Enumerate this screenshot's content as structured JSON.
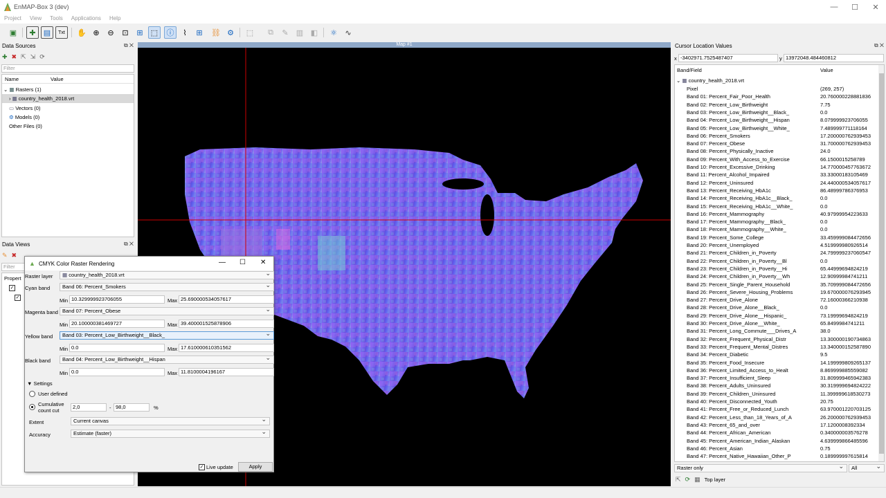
{
  "app": {
    "title": "EnMAP-Box 3 (dev)"
  },
  "window_controls": {
    "minimize": "—",
    "maximize": "☐",
    "close": "✕"
  },
  "menu": [
    "Project",
    "View",
    "Tools",
    "Applications",
    "Help"
  ],
  "toolbar_icons": [
    "open-project-icon",
    "add-data-icon",
    "save-icon",
    "text-icon",
    "pan-icon",
    "zoom-in-icon",
    "zoom-out-icon",
    "zoom-full-icon",
    "zoom-layer-icon",
    "select-icon",
    "identify-icon",
    "spectral-profile-icon",
    "pixel-grid-icon",
    "link-icon",
    "settings-icon",
    "select-features-icon",
    "deselect-icon",
    "digitize-icon",
    "save-edits-icon",
    "layer-style-icon",
    "processing-icon",
    "wave-icon"
  ],
  "data_sources": {
    "title": "Data Sources",
    "filter_placeholder": "Filter",
    "col_name": "Name",
    "col_value": "Value",
    "rasters": "Rasters (1)",
    "raster_file": "country_health_2018.vrt",
    "vectors": "Vectors (0)",
    "models": "Models (0)",
    "other": "Other Files (0)"
  },
  "data_views": {
    "title": "Data Views",
    "filter_placeholder": "Filter",
    "properties_label": "Propert"
  },
  "map": {
    "title": "Map #1"
  },
  "dialog": {
    "title": "CMYK Color Raster Rendering",
    "raster_layer_label": "Raster layer",
    "raster_layer_value": "country_health_2018.vrt",
    "cyan_label": "Cyan band",
    "cyan_band": "Band 06: Percent_Smokers",
    "cyan_min": "10.329999923706055",
    "cyan_max": "25.690000534057617",
    "magenta_label": "Magenta band",
    "magenta_band": "Band 07: Percent_Obese",
    "magenta_min": "20.100000381469727",
    "magenta_max": "39.400001525878906",
    "yellow_label": "Yellow band",
    "yellow_band": "Band 03: Percent_Low_Birthweight__Black_",
    "yellow_min": "0.0",
    "yellow_max": "17.610000610351562",
    "black_label": "Black band",
    "black_band": "Band 04: Percent_Low_Birthweight__Hispan",
    "black_min": "0.0",
    "black_max": "11.8100004196167",
    "min_label": "Min",
    "max_label": "Max",
    "settings_label": "Settings",
    "user_defined": "User defined",
    "cumulative_label_1": "Cumulative",
    "cumulative_label_2": "count cut",
    "cut_low": "2,0",
    "cut_high": "98,0",
    "dash": "-",
    "percent": "%",
    "extent_label": "Extent",
    "extent_value": "Current canvas",
    "accuracy_label": "Accuracy",
    "accuracy_value": "Estimate (faster)",
    "live_update": "Live update",
    "apply": "Apply"
  },
  "cursor_panel": {
    "title": "Cursor Location Values",
    "x_label": "x",
    "x_value": "-3402971.7525487407",
    "y_label": "y",
    "y_value": "13972048.484460812",
    "col_band": "Band/Field",
    "col_value": "Value",
    "layer_name": "country_health_2018.vrt",
    "rows": [
      [
        "Pixel",
        "(269, 257)"
      ],
      [
        "Band 01: Percent_Fair_Poor_Health",
        "20.760000228881836"
      ],
      [
        "Band 02: Percent_Low_Birthweight",
        "7.75"
      ],
      [
        "Band 03: Percent_Low_Birthweight__Black_",
        "0.0"
      ],
      [
        "Band 04: Percent_Low_Birthweight__Hispan",
        "8.079999923706055"
      ],
      [
        "Band 05: Percent_Low_Birthweight__White_",
        "7.489999771118164"
      ],
      [
        "Band 06: Percent_Smokers",
        "17.200000762939453"
      ],
      [
        "Band 07: Percent_Obese",
        "31.700000762939453"
      ],
      [
        "Band 08: Percent_Physically_Inactive",
        "24.0"
      ],
      [
        "Band 09: Percent_With_Access_to_Exercise",
        "66.1500015258789"
      ],
      [
        "Band 10: Percent_Excessive_Drinking",
        "14.770000457763672"
      ],
      [
        "Band 11: Percent_Alcohol_Impaired",
        "33.33000183105469"
      ],
      [
        "Band 12: Percent_Uninsured",
        "24.440000534057617"
      ],
      [
        "Band 13: Percent_Receiving_HbA1c",
        "86.48999786376953"
      ],
      [
        "Band 14: Percent_Receiving_HbA1c__Black_",
        "0.0"
      ],
      [
        "Band 15: Percent_Receiving_HbA1c__White_",
        "0.0"
      ],
      [
        "Band 16: Percent_Mammography",
        "40.97999954223633"
      ],
      [
        "Band 17: Percent_Mammography__Black_",
        "0.0"
      ],
      [
        "Band 18: Percent_Mammography__White_",
        "0.0"
      ],
      [
        "Band 19: Percent_Some_College",
        "33.459999084472656"
      ],
      [
        "Band 20: Percent_Unemployed",
        "4.519999980926514"
      ],
      [
        "Band 21: Percent_Children_in_Poverty",
        "24.799999237060547"
      ],
      [
        "Band 22: Percent_Children_in_Poverty__Bl",
        "0.0"
      ],
      [
        "Band 23: Percent_Children_in_Poverty__Hi",
        "65.44999694824219"
      ],
      [
        "Band 24: Percent_Children_in_Poverty__Wh",
        "12.90999984741211"
      ],
      [
        "Band 25: Percent_Single_Parent_Household",
        "35.709999084472656"
      ],
      [
        "Band 26: Percent_Severe_Housing_Problems",
        "19.670000076293945"
      ],
      [
        "Band 27: Percent_Drive_Alone",
        "72.16000366210938"
      ],
      [
        "Band 28: Percent_Drive_Alone__Black_",
        "0.0"
      ],
      [
        "Band 29: Percent_Drive_Alone__Hispanic_",
        "73.19999694824219"
      ],
      [
        "Band 30: Percent_Drive_Alone__White_",
        "65.8499984741211"
      ],
      [
        "Band 31: Percent_Long_Commute___Drives_A",
        "38.0"
      ],
      [
        "Band 32: Percent_Frequent_Physical_Distr",
        "13.300000190734863"
      ],
      [
        "Band 33: Percent_Frequent_Mental_Distres",
        "13.340000152587890"
      ],
      [
        "Band 34: Percent_Diabetic",
        "9.5"
      ],
      [
        "Band 35: Percent_Food_Insecure",
        "14.199999809265137"
      ],
      [
        "Band 36: Percent_Limited_Access_to_Healt",
        "8.869999885559082"
      ],
      [
        "Band 37: Percent_Insufficient_Sleep",
        "31.809999465942383"
      ],
      [
        "Band 38: Percent_Adults_Uninsured",
        "30.319999694824222"
      ],
      [
        "Band 39: Percent_Children_Uninsured",
        "11.399999618530273"
      ],
      [
        "Band 40: Percent_Disconnected_Youth",
        "20.75"
      ],
      [
        "Band 41: Percent_Free_or_Reduced_Lunch",
        "63.970001220703125"
      ],
      [
        "Band 42: Percent_Less_than_18_Years_of_A",
        "26.200000762939453"
      ],
      [
        "Band 43: Percent_65_and_over",
        "17.1200008392334"
      ],
      [
        "Band 44: Percent_African_American",
        "0.340000003576278"
      ],
      [
        "Band 45: Percent_American_Indian_Alaskan",
        "4.639999866485596"
      ],
      [
        "Band 46: Percent_Asian",
        "0.75"
      ],
      [
        "Band 47: Percent_Native_Hawaiian_Other_P",
        "0.189999997615814"
      ]
    ],
    "mode": "Raster only",
    "filter_all": "All",
    "top_layer": "Top layer"
  }
}
